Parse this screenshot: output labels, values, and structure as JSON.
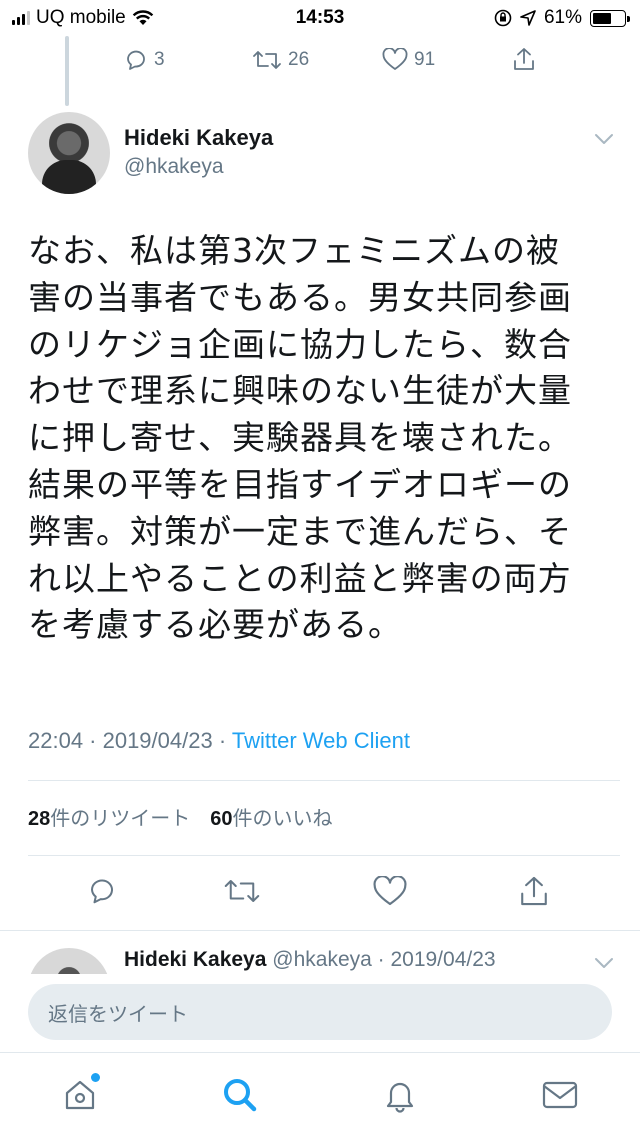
{
  "status_bar": {
    "carrier": "UQ mobile",
    "time": "14:53",
    "battery_percent": "61%",
    "battery_level": 0.61
  },
  "previous_tweet": {
    "replies": "3",
    "retweets": "26",
    "likes": "91"
  },
  "tweet": {
    "author_name": "Hideki Kakeya",
    "author_handle": "@hkakeya",
    "lines": [
      "なお、私は第3次フェミニズムの被",
      "害の当事者でもある。男女共同参画",
      "のリケジョ企画に協力したら、数合",
      "わせで理系に興味のない生徒が大量",
      "に押し寄せ、実験器具を壊された。",
      "結果の平等を目指すイデオロギーの",
      "弊害。対策が一定まで進んだら、そ",
      "れ以上やることの利益と弊害の両方",
      "を考慮する必要がある。"
    ],
    "timestamp": "22:04 · 2019/04/23 · ",
    "client": "Twitter Web Client",
    "retweet_count": "28",
    "retweet_label": "件のリツイート",
    "like_count": "60",
    "like_label": "件のいいね"
  },
  "next_tweet": {
    "author_name": "Hideki Kakeya",
    "meta": "@hkakeya · 2019/04/23"
  },
  "reply": {
    "placeholder": "返信をツイート"
  },
  "colors": {
    "accent": "#1da1f2",
    "muted": "#657786",
    "text": "#14171a"
  }
}
